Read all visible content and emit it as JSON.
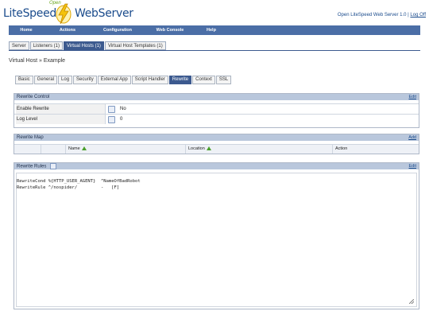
{
  "header": {
    "logo_open": "Open",
    "logo_lite": "LiteSpeed",
    "logo_web": "WebServer",
    "product_info": "Open LiteSpeed Web Server 1.0",
    "logout": "Log Off",
    "brand_color": "#1a4b8c",
    "bolt_color": "#f4c20d"
  },
  "main_nav": {
    "color": "#4b6ea6",
    "items": [
      "Home",
      "Actions",
      "Configuration",
      "Web Console",
      "Help"
    ]
  },
  "sub_tabs": {
    "items": [
      {
        "label": "Server",
        "active": false
      },
      {
        "label": "Listeners (1)",
        "active": false
      },
      {
        "label": "Virtual Hosts (1)",
        "active": true
      },
      {
        "label": "Virtual Host Templates (1)",
        "active": false
      }
    ]
  },
  "page_title": "Virtual Host » Example",
  "module_tabs": {
    "items": [
      {
        "label": "Basic",
        "active": false
      },
      {
        "label": "General",
        "active": false
      },
      {
        "label": "Log",
        "active": false
      },
      {
        "label": "Security",
        "active": false
      },
      {
        "label": "External App",
        "active": false
      },
      {
        "label": "Script Handler",
        "active": false
      },
      {
        "label": "Rewrite",
        "active": true
      },
      {
        "label": "Context",
        "active": false
      },
      {
        "label": "SSL",
        "active": false
      }
    ]
  },
  "rewrite_control": {
    "title": "Rewrite Control",
    "edit": "Edit",
    "rows": [
      {
        "label": "Enable Rewrite",
        "value": "No",
        "help_icon": "info-icon"
      },
      {
        "label": "Log Level",
        "value": "0",
        "help_icon": "info-icon"
      }
    ]
  },
  "rewrite_map": {
    "title": "Rewrite Map",
    "add": "Add",
    "columns": [
      "Name",
      "Location",
      "Action"
    ],
    "sort_icon": "sort-up-icon"
  },
  "rewrite_rules": {
    "title": "Rewrite Rules",
    "edit": "Edit",
    "line1": "RewriteCond %{HTTP_USER_AGENT}  ^NameOfBadRobot",
    "line2": "RewriteRule ^/nospider/         -   [F]"
  }
}
